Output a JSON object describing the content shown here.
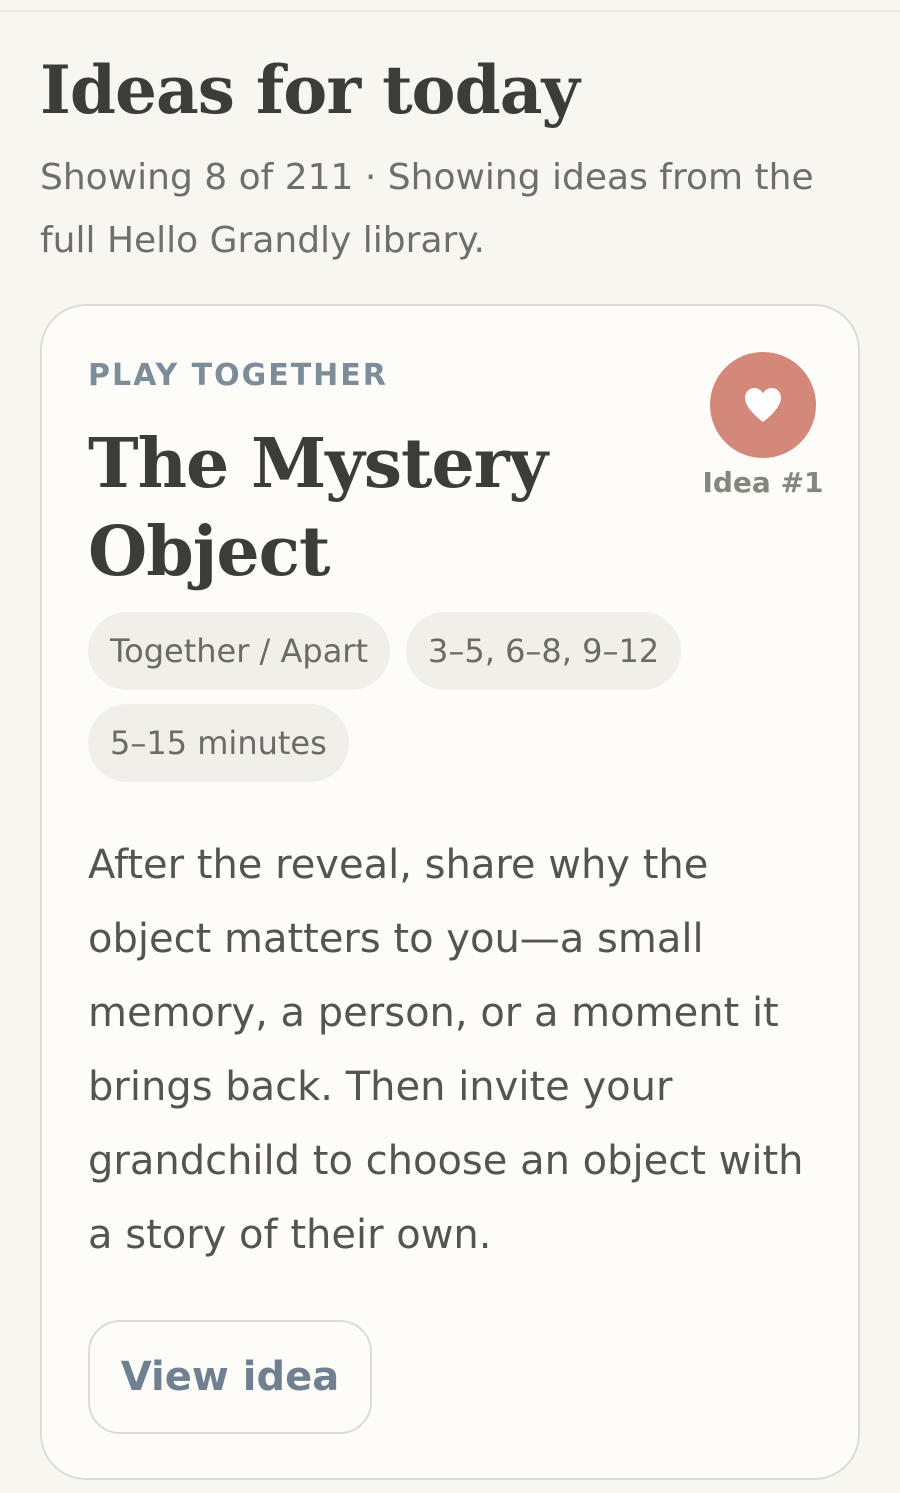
{
  "header": {
    "title": "Ideas for today",
    "summary": "Showing 8 of 211 · Showing ideas from the full Hello Grandly library."
  },
  "card": {
    "category": "PLAY TOGETHER",
    "title": "The Mystery Object",
    "favorite_icon": "heart-icon",
    "idea_number": "Idea #1",
    "tags": [
      "Together / Apart",
      "3–5, 6–8, 9–12",
      "5–15 minutes"
    ],
    "description": "After the reveal, share why the object matters to you—a small memory, a person, or a moment it brings back. Then invite your grandchild to choose an object with a story of their own.",
    "button_label": "View idea"
  },
  "colors": {
    "background": "#f8f6f1",
    "card_background": "#fdfcf9",
    "accent_heart": "#d3887a",
    "category_blue_gray": "#7c8c98",
    "tag_background": "#f1efe9"
  }
}
